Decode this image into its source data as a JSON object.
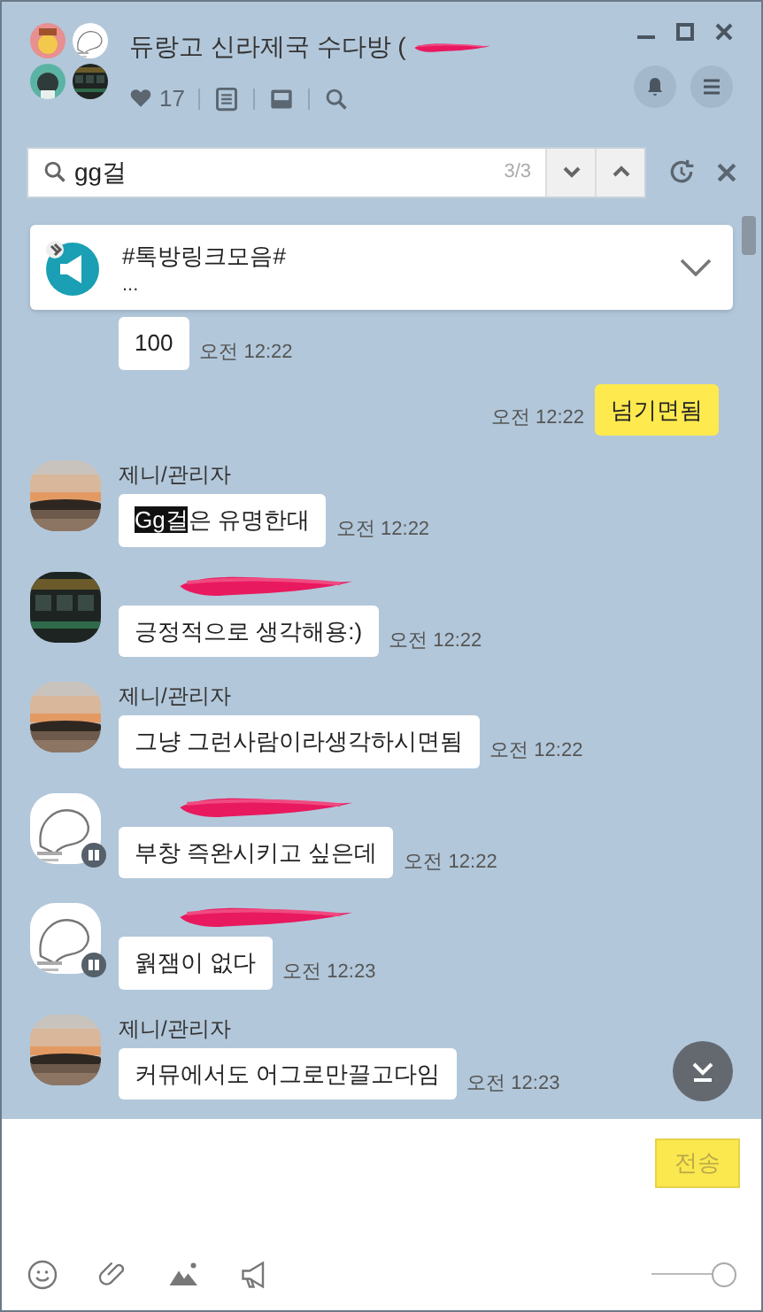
{
  "header": {
    "title": "듀랑고 신라제국 수다방 (",
    "title_redacted": true,
    "likes": "17"
  },
  "search": {
    "value": "gg걸",
    "count": "3/3"
  },
  "notice": {
    "title": "#톡방링크모음#",
    "body": "..."
  },
  "messages": [
    {
      "kind": "continuation",
      "text": "100",
      "time": "오전 12:22"
    },
    {
      "kind": "mine",
      "text": "넘기면됨",
      "time": "오전 12:22"
    },
    {
      "kind": "other",
      "sender": "제니/관리자",
      "parts": [
        {
          "text": "Gg걸",
          "highlighted": true
        },
        {
          "text": "은 유명한대",
          "highlighted": false
        }
      ],
      "time": "오전 12:22"
    },
    {
      "kind": "other",
      "sender_redacted": true,
      "text": "긍정적으로 생각해용:)",
      "time": "오전 12:22"
    },
    {
      "kind": "other",
      "sender": "제니/관리자",
      "text": "그냥 그런사람이라생각하시면됨",
      "time": "오전 12:22"
    },
    {
      "kind": "other",
      "sender_redacted": true,
      "badge": true,
      "text": "부창 즉완시키고 싶은데",
      "time": "오전 12:22"
    },
    {
      "kind": "other",
      "sender_redacted": true,
      "badge": true,
      "text": "웕잼이 없다",
      "time": "오전 12:23"
    },
    {
      "kind": "other",
      "sender": "제니/관리자",
      "text": "커뮤에서도 어그로만끌고다임",
      "time": "오전 12:23"
    }
  ],
  "composer": {
    "send_label": "전송",
    "send_enabled": false,
    "zoom_slider": {
      "level": 1
    }
  }
}
